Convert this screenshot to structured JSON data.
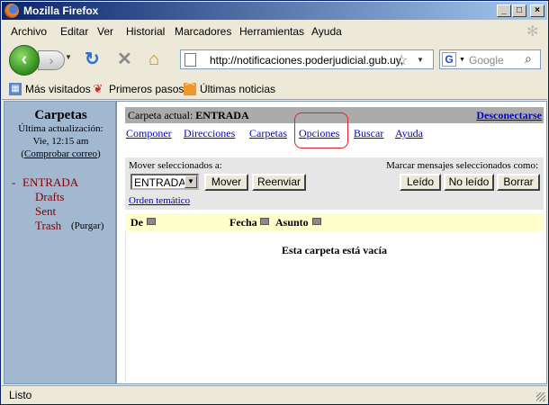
{
  "window": {
    "title": "Mozilla Firefox"
  },
  "menu": [
    "Archivo",
    "Editar",
    "Ver",
    "Historial",
    "Marcadores",
    "Herramientas",
    "Ayuda"
  ],
  "nav": {
    "url": "http://notificaciones.poderjudicial.gub.uy,",
    "search_placeholder": "Google"
  },
  "bookmarks": [
    "Más visitados",
    "Primeros pasos",
    "Últimas noticias"
  ],
  "sidebar": {
    "title": "Carpetas",
    "update_label": "Última actualización:",
    "update_time": "Vie, 12:15 am",
    "check_mail": "Comprobar correo",
    "check_mail_paren_open": "(",
    "check_mail_paren_close": ")",
    "folders": [
      {
        "name": "ENTRADA",
        "prefix": "-"
      },
      {
        "name": "Drafts"
      },
      {
        "name": "Sent"
      },
      {
        "name": "Trash",
        "extra": "(Purgar)"
      }
    ]
  },
  "main": {
    "current_label": "Carpeta actual:",
    "current_folder": "ENTRADA",
    "logout": "Desconectarse",
    "links": [
      "Componer",
      "Direcciones",
      "Carpetas",
      "Opciones",
      "Buscar",
      "Ayuda"
    ],
    "move_label": "Mover seleccionados a:",
    "move_select": "ENTRADA",
    "move_btn": "Mover",
    "forward_btn": "Reenviar",
    "mark_label": "Marcar mensajes seleccionados como:",
    "read_btn": "Leído",
    "unread_btn": "No leído",
    "delete_btn": "Borrar",
    "thread_sort": "Orden temático",
    "col_from": "De",
    "col_date": "Fecha",
    "col_subject": "Asunto",
    "empty_msg": "Esta carpeta está vacía"
  },
  "status": {
    "text": "Listo"
  },
  "colors": {
    "highlight": "#e0202a",
    "link": "#0000cc",
    "sidebar": "#a2b8d0",
    "folder": "#800000"
  }
}
